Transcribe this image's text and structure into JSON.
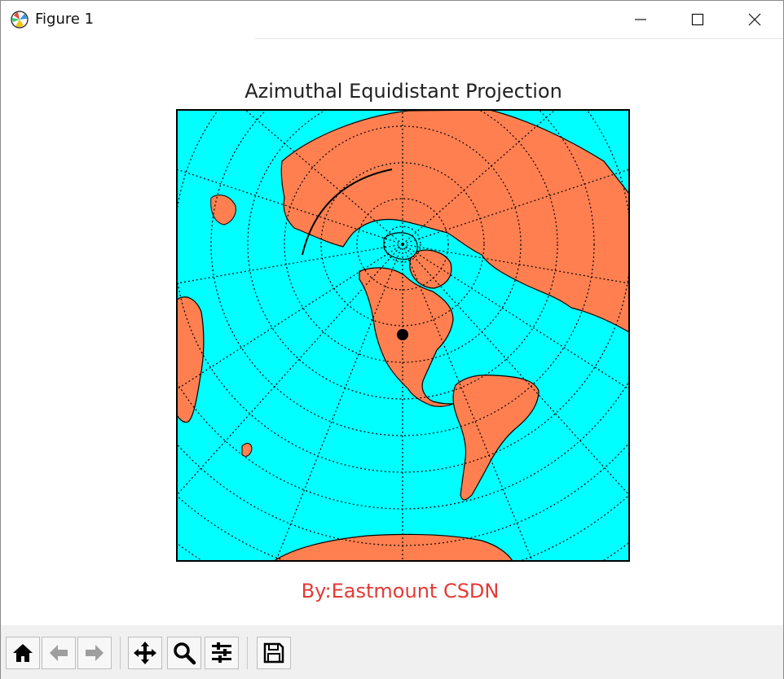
{
  "window": {
    "title": "Figure 1",
    "controls": [
      {
        "name": "minimize",
        "icon": "minimize-icon"
      },
      {
        "name": "maximize",
        "icon": "maximize-icon"
      },
      {
        "name": "close",
        "icon": "close-icon"
      }
    ]
  },
  "plot": {
    "title": "Azimuthal Equidistant Projection",
    "credit": "By:Eastmount CSDN",
    "colors": {
      "ocean": "#00ffff",
      "land": "#ff7f50",
      "coastline": "#000000",
      "gridline": "#000000",
      "credit_text": "#e53935"
    }
  },
  "toolbar": {
    "buttons": [
      {
        "name": "home",
        "icon": "home-icon"
      },
      {
        "name": "back",
        "icon": "back-arrow-icon"
      },
      {
        "name": "forward",
        "icon": "forward-arrow-icon"
      },
      {
        "name": "pan",
        "icon": "pan-icon"
      },
      {
        "name": "zoom",
        "icon": "zoom-icon"
      },
      {
        "name": "configure-subplots",
        "icon": "sliders-icon"
      },
      {
        "name": "save",
        "icon": "save-icon"
      }
    ]
  }
}
